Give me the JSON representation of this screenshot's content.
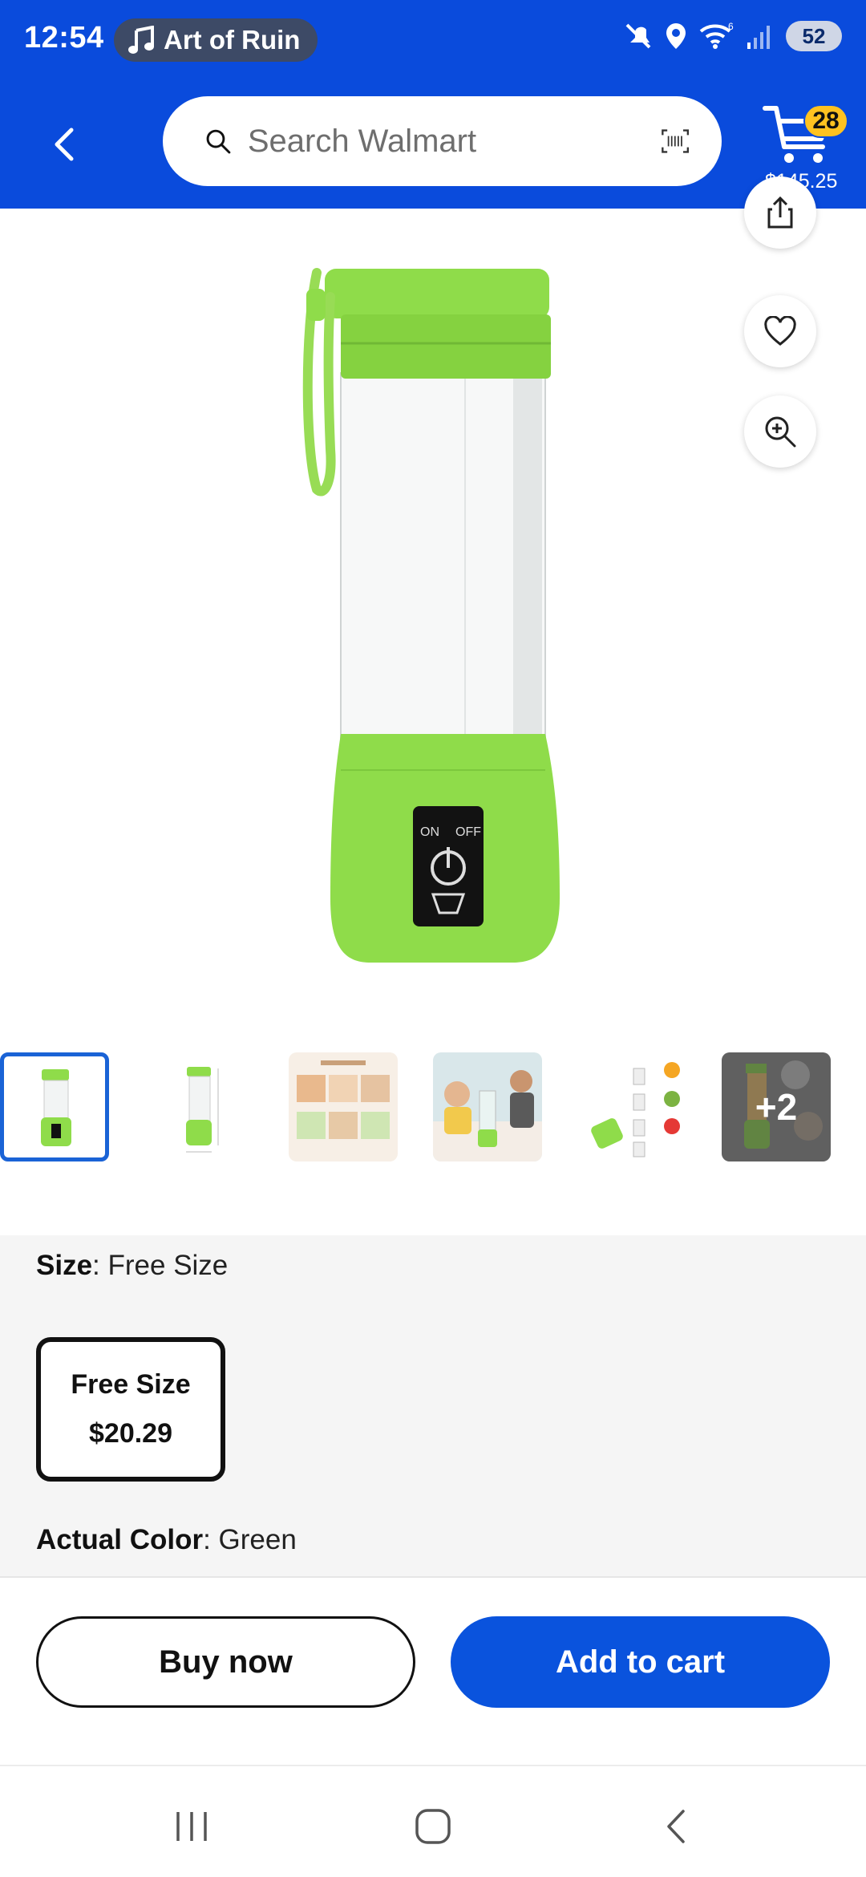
{
  "status_bar": {
    "time": "12:54",
    "media_title": "Art of Ruin",
    "wifi_label": "6",
    "battery": "52"
  },
  "header": {
    "search_placeholder": "Search Walmart",
    "cart_count": "28",
    "cart_total": "$145.25"
  },
  "gallery": {
    "thumbnail_count": 6,
    "selected_index": 0,
    "more_label": "+2"
  },
  "options": {
    "size_label": "Size",
    "size_value": "Free Size",
    "size_choice_name": "Free Size",
    "size_choice_price": "$20.29",
    "color_label": "Actual Color",
    "color_value": "Green",
    "separator": ": "
  },
  "actions": {
    "buy_now": "Buy now",
    "add_to_cart": "Add to cart"
  },
  "theme": {
    "header_blue": "#0a4bdc",
    "badge_yellow": "#ffc220",
    "product_green": "#8fdc4a"
  }
}
